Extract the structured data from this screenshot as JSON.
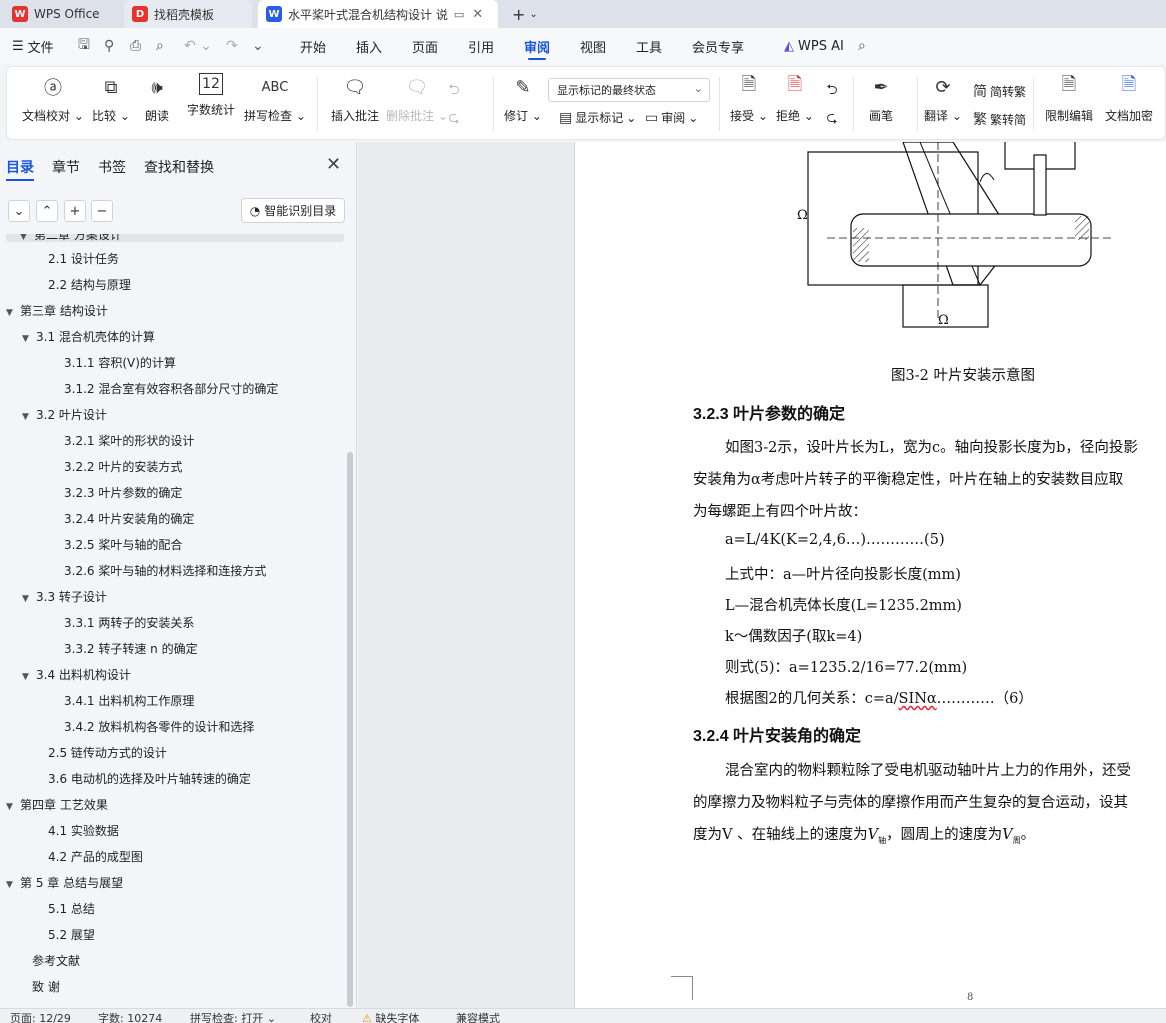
{
  "tabs": [
    {
      "label": "WPS Office",
      "icon": "wps-logo-icon",
      "color": "#e5342b"
    },
    {
      "label": "找稻壳模板",
      "icon": "docer-icon",
      "color": "#e5342b"
    },
    {
      "label": "水平桨叶式混合机结构设计 说",
      "icon": "word-doc-icon",
      "color": "#2b5ce6"
    }
  ],
  "menu": {
    "file": "文件",
    "items": [
      "开始",
      "插入",
      "页面",
      "引用",
      "审阅",
      "视图",
      "工具",
      "会员专享"
    ],
    "active": "审阅",
    "ai": "WPS AI"
  },
  "ribbon": {
    "proofread": "文档校对",
    "compare": "比较",
    "read_aloud": "朗读",
    "word_count": "字数统计",
    "spell_check": "拼写检查",
    "insert_comment": "插入批注",
    "delete_comment": "删除批注",
    "track": "修订",
    "display_mode": "显示标记的最终状态",
    "show_markup": "显示标记",
    "review": "审阅",
    "accept": "接受",
    "reject": "拒绝",
    "pen": "画笔",
    "translate": "翻译",
    "to_traditional": "简转繁",
    "to_simplified": "繁转简",
    "restrict": "限制编辑",
    "encrypt": "文档加密"
  },
  "panel": {
    "tabs": [
      "目录",
      "章节",
      "书签",
      "查找和替换"
    ],
    "smart_toc": "智能识别目录",
    "toc_cut": "第二章  方案设计",
    "toc": [
      {
        "text": "2.1 设计任务",
        "level": 1,
        "arrow": false
      },
      {
        "text": "2.2 结构与原理",
        "level": 1,
        "arrow": false
      },
      {
        "text": "第三章  结构设计",
        "level": 0,
        "arrow": true
      },
      {
        "text": "3.1 混合机壳体的计算",
        "level": 1,
        "arrow": true
      },
      {
        "text": "3.1.1  容积(V)的计算",
        "level": 2,
        "arrow": false
      },
      {
        "text": "3.1.2  混合室有效容积各部分尺寸的确定",
        "level": 2,
        "arrow": false
      },
      {
        "text": "3.2 叶片设计",
        "level": 1,
        "arrow": true
      },
      {
        "text": "3.2.1 桨叶的形状的设计",
        "level": 2,
        "arrow": false
      },
      {
        "text": "3.2.2  叶片的安装方式",
        "level": 2,
        "arrow": false
      },
      {
        "text": "3.2.3  叶片参数的确定",
        "level": 2,
        "arrow": false
      },
      {
        "text": "3.2.4  叶片安装角的确定",
        "level": 2,
        "arrow": false
      },
      {
        "text": "3.2.5  桨叶与轴的配合",
        "level": 2,
        "arrow": false
      },
      {
        "text": "3.2.6 桨叶与轴的材料选择和连接方式",
        "level": 2,
        "arrow": false
      },
      {
        "text": "3.3  转子设计",
        "level": 1,
        "arrow": true
      },
      {
        "text": "3.3.1  两转子的安装关系",
        "level": 2,
        "arrow": false
      },
      {
        "text": "3.3.2  转子转速 n 的确定",
        "level": 2,
        "arrow": false
      },
      {
        "text": "3.4  出料机构设计",
        "level": 1,
        "arrow": true
      },
      {
        "text": "3.4.1 出料机构工作原理",
        "level": 2,
        "arrow": false
      },
      {
        "text": "3.4.2  放料机构各零件的设计和选择",
        "level": 2,
        "arrow": false
      },
      {
        "text": "2.5 链传动方式的设计",
        "level": 1,
        "arrow": false
      },
      {
        "text": "3.6 电动机的选择及叶片轴转速的确定",
        "level": 1,
        "arrow": false
      },
      {
        "text": "第四章  工艺效果",
        "level": 0,
        "arrow": true
      },
      {
        "text": "4.1 实验数据",
        "level": 1,
        "arrow": false
      },
      {
        "text": "4.2 产品的成型图",
        "level": 1,
        "arrow": false
      },
      {
        "text": "第 5 章  总结与展望",
        "level": 0,
        "arrow": true
      },
      {
        "text": "5.1  总结",
        "level": 1,
        "arrow": false
      },
      {
        "text": "5.2  展望",
        "level": 1,
        "arrow": false
      },
      {
        "text": "参考文献",
        "level": 0,
        "arrow": false
      },
      {
        "text": "致    谢",
        "level": 0,
        "arrow": false
      }
    ]
  },
  "doc": {
    "figure_caption": "图3-2  叶片安装示意图",
    "fig_label_left": "Ω",
    "fig_label_bottom": "Ω",
    "h_323": "3.2.3  叶片参数的确定",
    "p1": "如图3-2示，设叶片长为L，宽为c。轴向投影长度为b，径向投影",
    "p2": "安装角为α考虑叶片转子的平衡稳定性，叶片在轴上的安装数目应取",
    "p3": "为每螺距上有四个叶片故：",
    "f1": "a=L/4K(K=2,4,6…)…………(5)",
    "f2": "上式中：a—叶片径向投影长度(mm)",
    "f3": "L—混合机壳体长度(L=1235.2mm)",
    "f4": "k～偶数因子(取k=4)",
    "f5": "则式(5)：a=1235.2/16=77.2(mm)",
    "f6_pre": "根据图2的几何关系：c=a/",
    "f6_err": "SINα",
    "f6_post": "…………（6）",
    "h_324": "3.2.4  叶片安装角的确定",
    "q1": "混合室内的物料颗粒除了受电机驱动轴叶片上力的作用外，还受",
    "q2": "的摩擦力及物料粒子与壳体的摩擦作用而产生复杂的复合运动，设其",
    "q3_a": "度为V  、在轴线上的速度为",
    "q3_v1": "V",
    "q3_s1": "轴",
    "q3_b": "，圆周上的速度为",
    "q3_v2": "V",
    "q3_s2": "周",
    "q3_c": "。",
    "page_number": "8"
  },
  "status": {
    "page": "页面: 12/29",
    "words": "字数: 10274",
    "spell": "拼写检查: 打开",
    "proof": "校对",
    "missing_font": "缺失字体",
    "compat": "兼容模式"
  }
}
